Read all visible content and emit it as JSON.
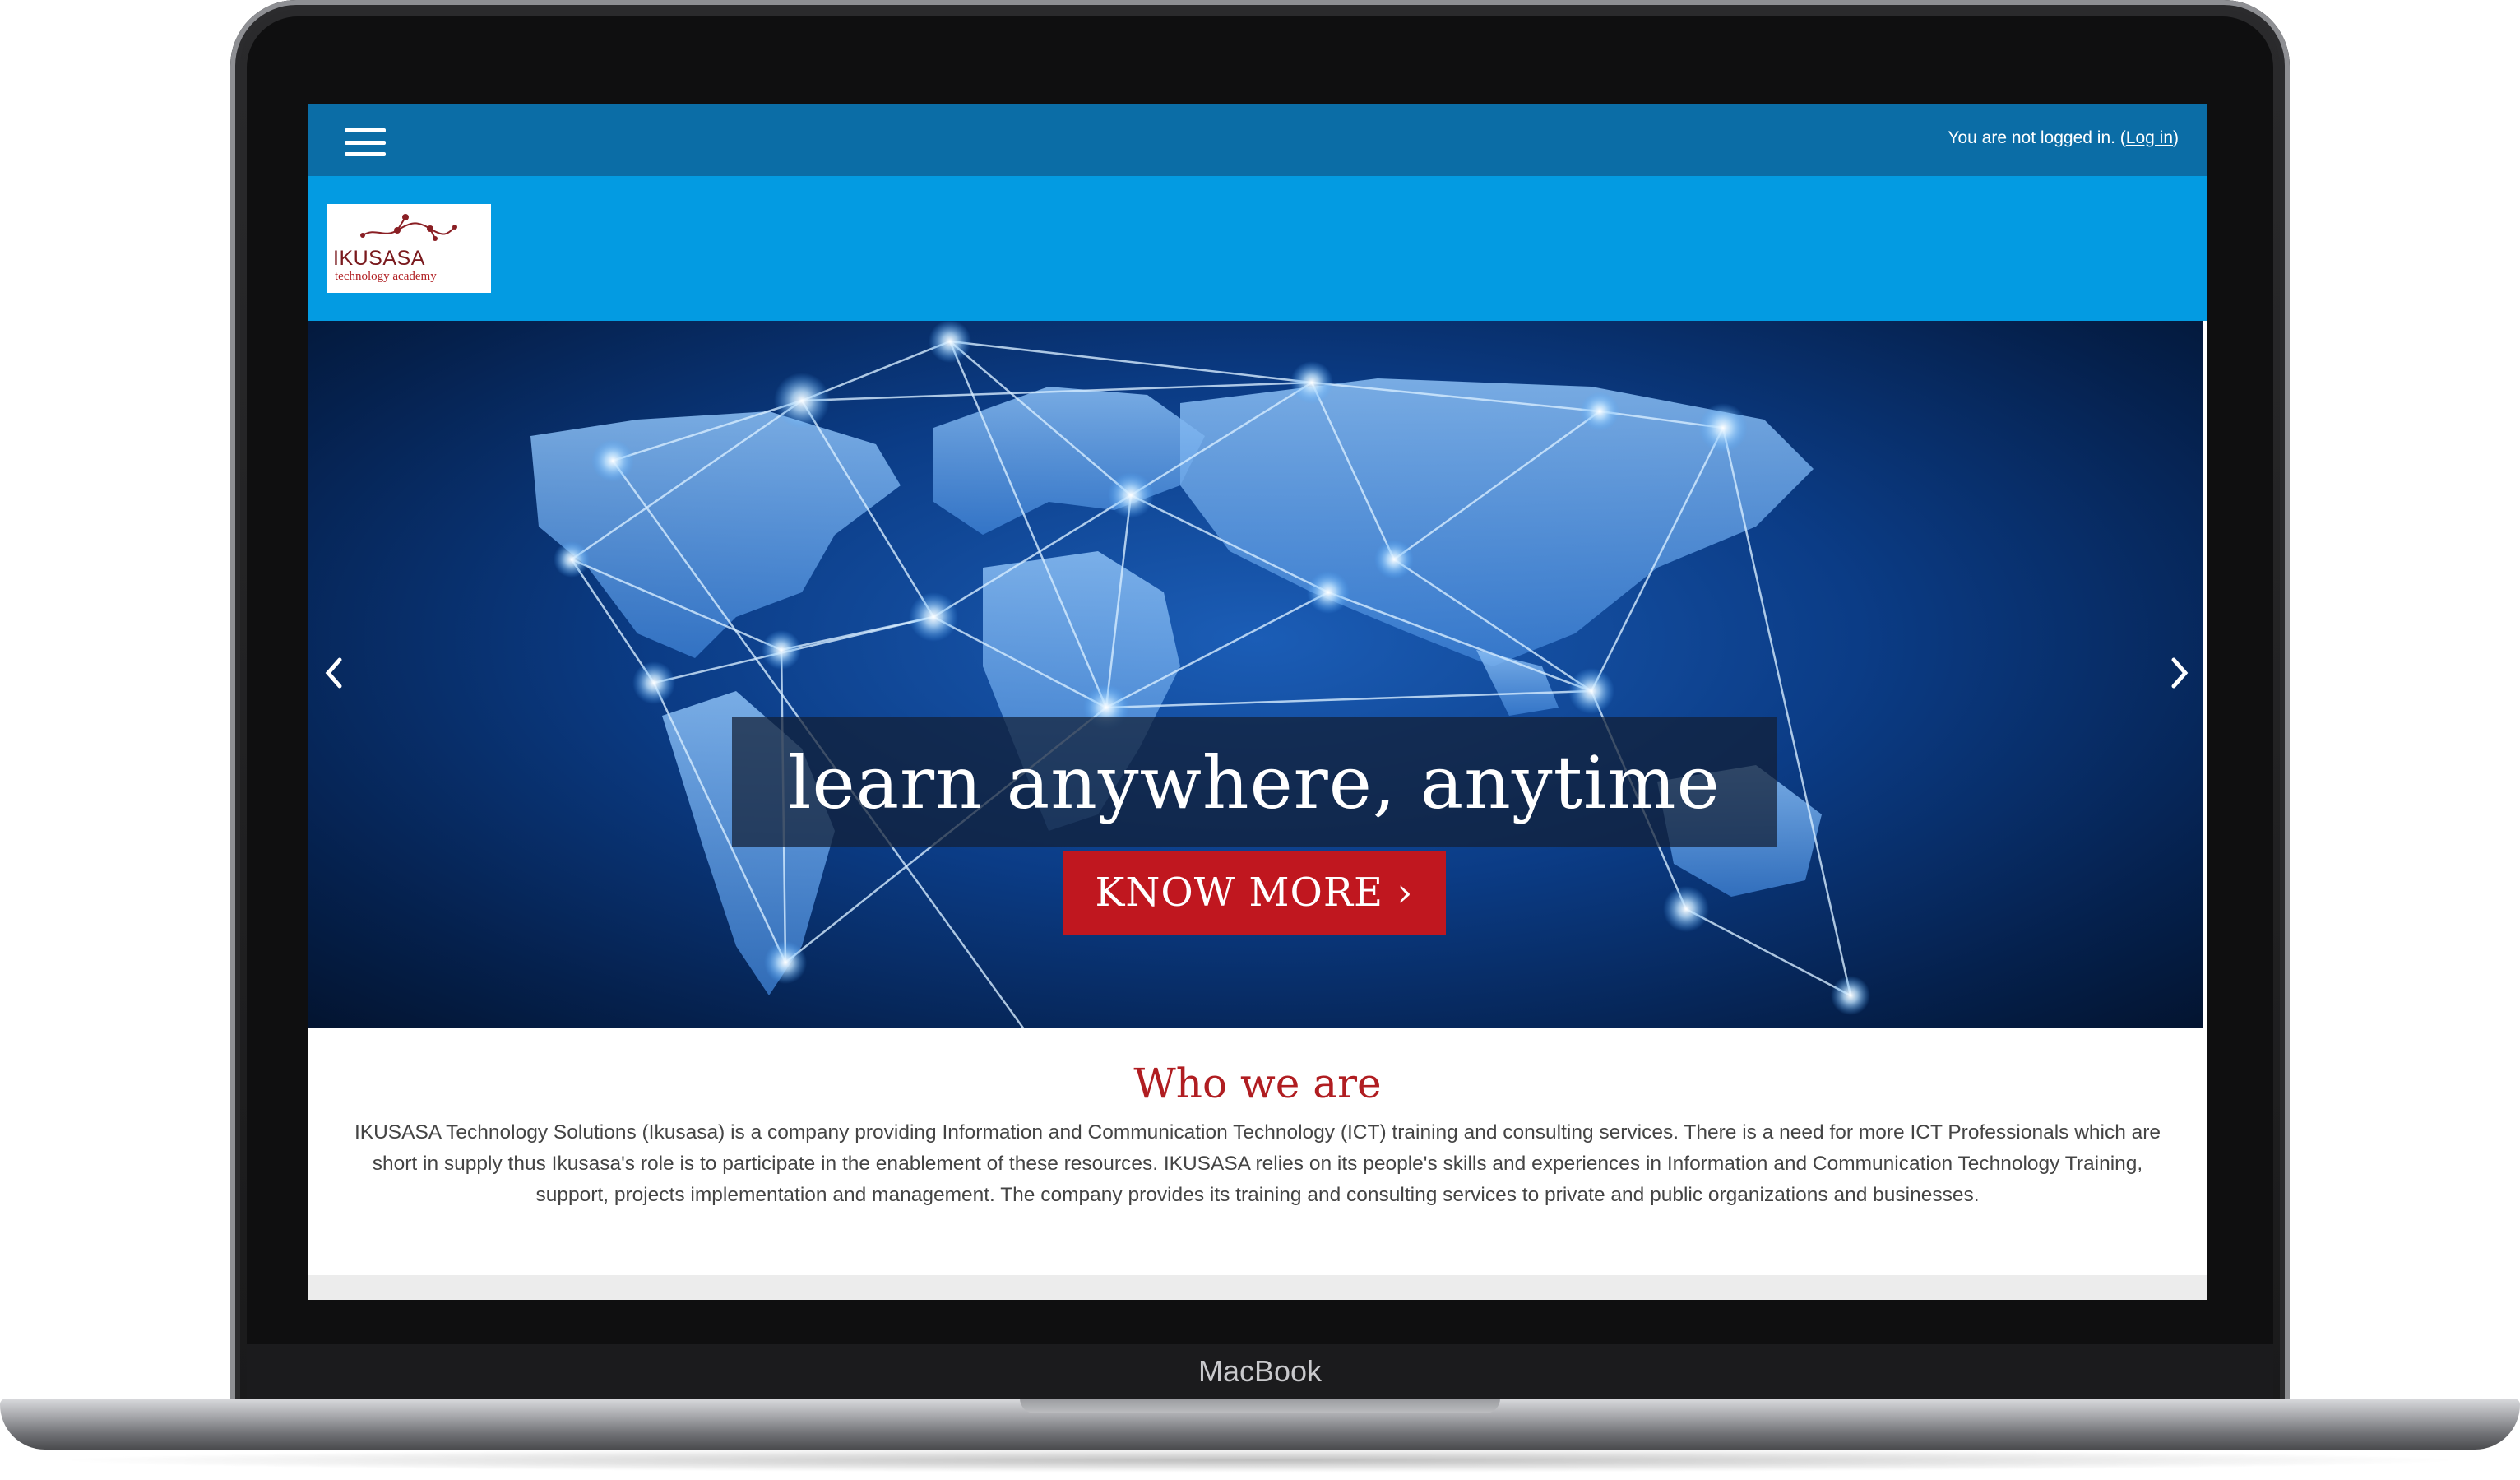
{
  "device": {
    "brand_label": "MacBook"
  },
  "header": {
    "login_status_text": "You are not logged in. (",
    "login_link_label": "Log in",
    "login_status_suffix": ")",
    "menu_icon": "hamburger-icon"
  },
  "logo": {
    "name": "IKUSASA",
    "subtitle": "technology academy"
  },
  "hero": {
    "caption": "learn anywhere, anytime",
    "cta_label": "KNOW MORE ›",
    "prev_icon": "chevron-left-icon",
    "next_icon": "chevron-right-icon"
  },
  "about": {
    "title": "Who we are",
    "body": "IKUSASA Technology Solutions (Ikusasa) is a company providing Information and Communication Technology (ICT) training and consulting services. There is a need for more ICT Professionals which are short in supply thus Ikusasa's role is to participate in the enablement of these resources. IKUSASA relies on its people's skills and experiences in Information and Communication Technology Training, support, projects implementation and management. The company provides its training and consulting services to private and public organizations and businesses."
  },
  "colors": {
    "topbar": "#0b6da6",
    "header_band": "#039be2",
    "accent_red": "#c0171f",
    "title_red": "#b01d21"
  }
}
